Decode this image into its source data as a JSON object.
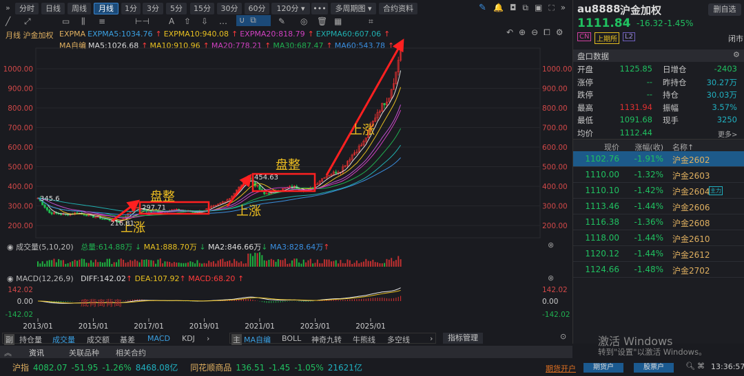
{
  "toolbar": {
    "periods": [
      "分时",
      "日线",
      "周线",
      "月线",
      "1分",
      "3分",
      "5分",
      "15分",
      "30分",
      "60分",
      "120分 ▾",
      "•••",
      "多周期图 ▾",
      "合约资料"
    ],
    "active": "月线"
  },
  "chart_header": {
    "period": "月线",
    "name": "沪金加权"
  },
  "expma": {
    "label": "EXPMA",
    "items": [
      {
        "t": "EXPMA5:1034.76",
        "c": "#3a9fe0"
      },
      {
        "t": "EXPMA10:940.08",
        "c": "#e8c020"
      },
      {
        "t": "EXPMA20:818.79",
        "c": "#d040c0"
      },
      {
        "t": "EXPMA60:607.06",
        "c": "#20b0b0"
      }
    ]
  },
  "ma": {
    "label": "MA自编",
    "items": [
      {
        "t": "MA5:1026.68",
        "c": "#dddddd"
      },
      {
        "t": "MA10:910.96",
        "c": "#e8c020"
      },
      {
        "t": "MA20:778.21",
        "c": "#d040c0"
      },
      {
        "t": "MA30:687.47",
        "c": "#20b050"
      },
      {
        "t": "MA60:543.78",
        "c": "#3a8fe0"
      }
    ]
  },
  "y_labels": [
    "1000.00",
    "900.00",
    "800.00",
    "700.00",
    "600.00",
    "500.00",
    "400.00",
    "300.00",
    "200.00"
  ],
  "volume": {
    "label": "成交量(5,10,20)",
    "total": "总量:614.88万",
    "ma1": "MA1:888.70万",
    "ma2": "MA2:846.66万",
    "ma3": "MA3:828.64万"
  },
  "macd": {
    "label": "MACD(12,26,9)",
    "diff": "DIFF:142.02",
    "dea": "DEA:107.92",
    "macd": "MACD:68.20",
    "y_labels": [
      "142.02",
      "0.00",
      "-142.02"
    ],
    "note": "底背离背离"
  },
  "x_labels": [
    "2013/01",
    "2015/01",
    "2017/01",
    "2019/01",
    "2021/01",
    "2023/01",
    "2025/01"
  ],
  "annotations": {
    "up1": "上涨",
    "flat1": "盘整",
    "up2": "上涨",
    "flat2": "盘整",
    "up3": "上涨",
    "p1": "345.6",
    "p2": "216.81",
    "p3": "297.71",
    "p4": "454.63"
  },
  "chart_data": {
    "type": "candlestick",
    "title": "月线 沪金加权",
    "x_ticks": [
      "2013/01",
      "2015/01",
      "2017/01",
      "2019/01",
      "2021/01",
      "2023/01",
      "2025/01"
    ],
    "ylim": [
      200,
      1200
    ],
    "keypoints": [
      [
        "2013/01",
        340
      ],
      [
        "2013/06",
        265
      ],
      [
        "2014/01",
        255
      ],
      [
        "2014/06",
        265
      ],
      [
        "2015/01",
        245
      ],
      [
        "2015/12",
        218
      ],
      [
        "2016/07",
        292
      ],
      [
        "2017/01",
        272
      ],
      [
        "2018/01",
        278
      ],
      [
        "2018/10",
        266
      ],
      [
        "2019/06",
        300
      ],
      [
        "2019/12",
        340
      ],
      [
        "2020/08",
        445
      ],
      [
        "2021/03",
        360
      ],
      [
        "2022/03",
        398
      ],
      [
        "2022/10",
        378
      ],
      [
        "2023/05",
        450
      ],
      [
        "2023/12",
        482
      ],
      [
        "2024/05",
        560
      ],
      [
        "2024/10",
        625
      ],
      [
        "2025/04",
        780
      ],
      [
        "2025/09",
        860
      ],
      [
        "2025/12",
        980
      ],
      [
        "2026/02",
        1111.84
      ]
    ]
  },
  "sub_tabs": {
    "tag": "副",
    "items": [
      "持仓量",
      "成交量",
      "成交额",
      "基差",
      "MACD",
      "KDJ",
      "›"
    ]
  },
  "main_tabs": {
    "tag": "主",
    "items": [
      "MA自编",
      "BOLL",
      "神奇九转",
      "牛熊线",
      "多空线",
      "›"
    ]
  },
  "indicator_manage": "指标管理",
  "info_tabs": [
    "资讯",
    "关联品种",
    "相关合约"
  ],
  "ticker": {
    "a_name": "沪指",
    "a_price": "4082.07",
    "a_chg": "-51.95",
    "a_pct": "-1.26%",
    "a_amt": "8468.08亿",
    "b_name": "同花顺商品",
    "b_price": "136.51",
    "b_chg": "-1.45",
    "b_pct": "-1.05%",
    "b_amt": "21621亿"
  },
  "status": {
    "open_account": "期货开户",
    "futures_btn": "期货户",
    "stock_btn": "股票户",
    "time": "13:36:57"
  },
  "watermark": {
    "l1": "激活 Windows",
    "l2": "转到\"设置\"以激活 Windows。"
  },
  "quote": {
    "code": "au8888",
    "name": "沪金加权",
    "remove": "删自选",
    "price": "1111.84",
    "chg": "-16.32",
    "pct": "-1.45%",
    "tags": [
      "CN",
      "上期所",
      "L2"
    ],
    "state": "闭市",
    "section": "盘口数据",
    "left": [
      [
        "开盘",
        "1125.85"
      ],
      [
        "涨停",
        "--"
      ],
      [
        "跌停",
        "--"
      ],
      [
        "最高",
        "1131.94"
      ],
      [
        "最低",
        "1091.68"
      ],
      [
        "均价",
        "1112.44"
      ]
    ],
    "right": [
      [
        "日增仓",
        "-2403"
      ],
      [
        "昨持仓",
        "30.27万"
      ],
      [
        "持仓",
        "30.03万"
      ],
      [
        "振幅",
        "3.57%"
      ],
      [
        "现手",
        "3250"
      ]
    ],
    "more": "更多>"
  },
  "contracts": {
    "headers": [
      "现价",
      "涨幅(收)",
      "名称↑"
    ],
    "badge": "主力",
    "rows": [
      [
        "1102.76",
        "-1.91%",
        "沪金2602"
      ],
      [
        "1110.00",
        "-1.32%",
        "沪金2603"
      ],
      [
        "1110.10",
        "-1.42%",
        "沪金2604"
      ],
      [
        "1113.46",
        "-1.44%",
        "沪金2606"
      ],
      [
        "1116.38",
        "-1.36%",
        "沪金2608"
      ],
      [
        "1118.00",
        "-1.44%",
        "沪金2610"
      ],
      [
        "1120.12",
        "-1.44%",
        "沪金2612"
      ],
      [
        "1124.66",
        "-1.48%",
        "沪金2702"
      ]
    ]
  }
}
